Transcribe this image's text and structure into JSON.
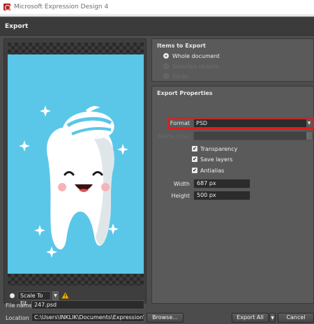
{
  "window": {
    "title": "Microsoft Expression Design 4",
    "icon": "expression-design-app-icon"
  },
  "dialog": {
    "title": "Export"
  },
  "preview": {
    "zoom_value": "Scale To Fit",
    "icons": {
      "warning": "warning-icon",
      "dropdown": "chevron-down-icon"
    },
    "artwork_colors": {
      "background": "#5ac7e8",
      "tooth": "#ffffff",
      "paste_stripe": "#5ac7e8"
    }
  },
  "items_to_export": {
    "title": "Items to Export",
    "options": [
      {
        "label": "Whole document",
        "selected": true,
        "enabled": true
      },
      {
        "label": "Selected objects",
        "selected": false,
        "enabled": false
      },
      {
        "label": "Slices",
        "selected": false,
        "enabled": false
      }
    ]
  },
  "export_properties": {
    "title": "Export Properties",
    "format_label": "Format",
    "format_value": "PSD",
    "matte_label": "Matte color",
    "checkboxes": [
      {
        "label": "Transparency",
        "checked": true
      },
      {
        "label": "Save layers",
        "checked": true
      },
      {
        "label": "Antialias",
        "checked": true
      }
    ],
    "width_label": "Width",
    "width_value": "687 px",
    "height_label": "Height",
    "height_value": "500 px"
  },
  "footer": {
    "file_name_label": "File name",
    "file_name_value": "247.psd",
    "location_label": "Location",
    "location_value": "C:\\Users\\INKLIK\\Documents\\Expression\\",
    "browse_label": "Browse...",
    "export_all_label": "Export All",
    "cancel_label": "Cancel"
  },
  "colors": {
    "highlight": "#e21b1b",
    "panel": "#5a5a5a",
    "dialog_bg": "#4c4c4c"
  }
}
